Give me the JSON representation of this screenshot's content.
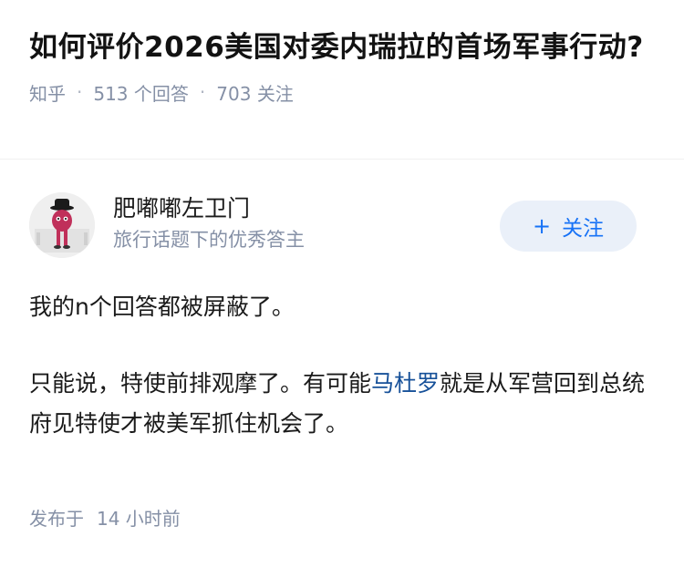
{
  "question": {
    "title": "如何评价2026美国对委内瑞拉的首场军事行动?",
    "platform": "知乎",
    "answer_count": "513",
    "answer_label": "个回答",
    "follower_count": "703",
    "follower_label": "关注"
  },
  "author": {
    "name": "肥嘟嘟左卫门",
    "description": "旅行话题下的优秀答主",
    "follow_label": "关注",
    "follow_icon": "+"
  },
  "answer": {
    "paragraph1": "我的n个回答都被屏蔽了。",
    "paragraph2_before": "只能说，特使前排观摩了。有可能",
    "paragraph2_link": "马杜罗",
    "paragraph2_after": "就是从军营回到总统府见特使才被美军抓住机会了。"
  },
  "footer": {
    "published_label": "发布于",
    "published_time": "14 小时前"
  },
  "colors": {
    "accent": "#1772f6",
    "link": "#175199",
    "meta": "#8590a6",
    "follow_bg": "#eaf0f9"
  }
}
